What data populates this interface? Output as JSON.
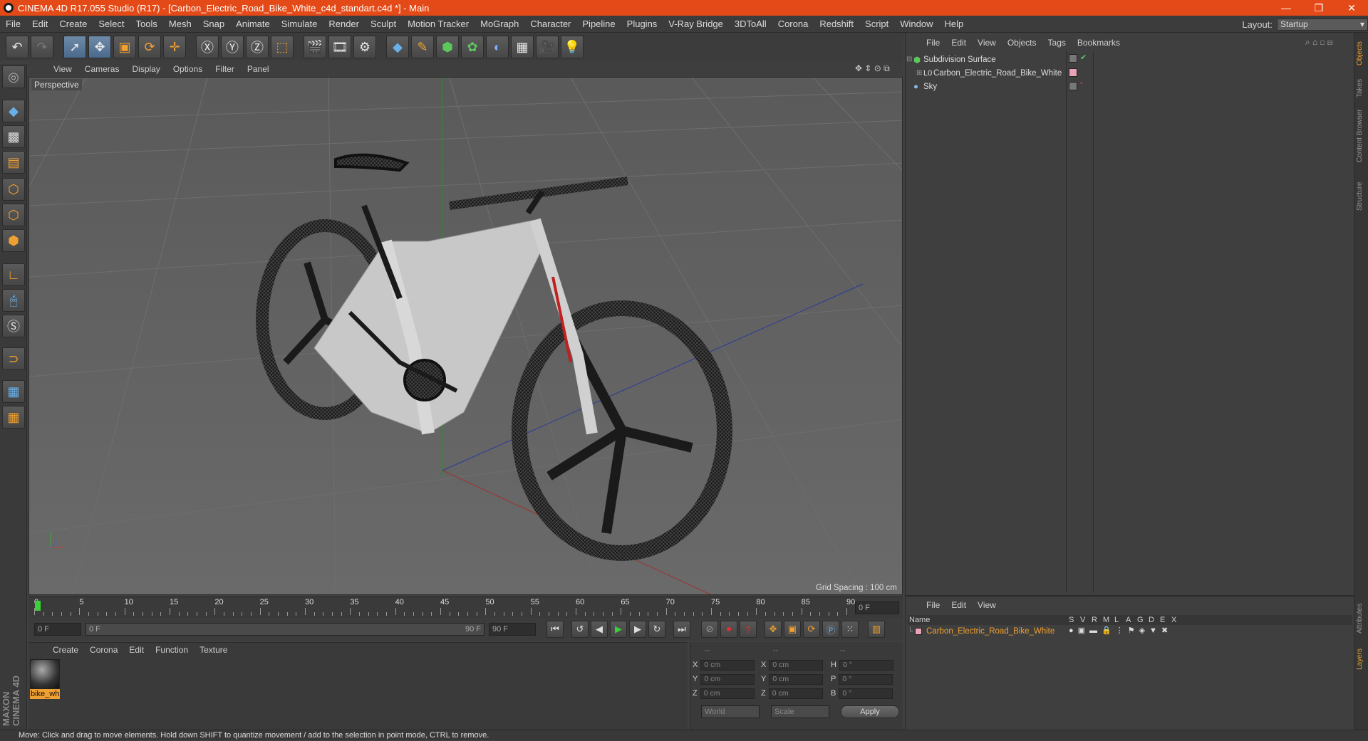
{
  "window": {
    "title": "CINEMA 4D R17.055 Studio (R17) - [Carbon_Electric_Road_Bike_White_c4d_standart.c4d *] - Main",
    "buttons": [
      "—",
      "❐",
      "✕"
    ]
  },
  "menubar": [
    "File",
    "Edit",
    "Create",
    "Select",
    "Tools",
    "Mesh",
    "Snap",
    "Animate",
    "Simulate",
    "Render",
    "Sculpt",
    "Motion Tracker",
    "MoGraph",
    "Character",
    "Pipeline",
    "Plugins",
    "V-Ray Bridge",
    "3DToAll",
    "Corona",
    "Redshift",
    "Script",
    "Window",
    "Help"
  ],
  "layout": {
    "label": "Layout:",
    "value": "Startup"
  },
  "viewport": {
    "menu": [
      "View",
      "Cameras",
      "Display",
      "Options",
      "Filter",
      "Panel"
    ],
    "label": "Perspective",
    "grid_spacing": "Grid Spacing : 100 cm"
  },
  "timeline": {
    "ticks": [
      "0",
      "5",
      "10",
      "15",
      "20",
      "25",
      "30",
      "35",
      "40",
      "45",
      "50",
      "55",
      "60",
      "65",
      "70",
      "75",
      "80",
      "85",
      "90"
    ],
    "current_frame": "0 F",
    "start": "0 F",
    "range_start": "0 F",
    "range_end": "90 F",
    "end": "90 F"
  },
  "material_manager": {
    "menu": [
      "Create",
      "Corona",
      "Edit",
      "Function",
      "Texture"
    ],
    "materials": [
      {
        "name": "bike_wh"
      }
    ]
  },
  "coordinates": {
    "headers": [
      "--",
      "--",
      "--"
    ],
    "rows": [
      {
        "a": "X",
        "av": "0 cm",
        "b": "X",
        "bv": "0 cm",
        "c": "H",
        "cv": "0 °"
      },
      {
        "a": "Y",
        "av": "0 cm",
        "b": "Y",
        "bv": "0 cm",
        "c": "P",
        "cv": "0 °"
      },
      {
        "a": "Z",
        "av": "0 cm",
        "b": "Z",
        "bv": "0 cm",
        "c": "B",
        "cv": "0 °"
      }
    ],
    "world": "World",
    "scale": "Scale",
    "apply": "Apply"
  },
  "object_manager": {
    "menu": [
      "File",
      "Edit",
      "View",
      "Objects",
      "Tags",
      "Bookmarks"
    ],
    "objects": [
      {
        "name": "Subdivision Surface",
        "indent": 0
      },
      {
        "name": "Carbon_Electric_Road_Bike_White",
        "indent": 1
      },
      {
        "name": "Sky",
        "indent": 0
      }
    ]
  },
  "layer_manager": {
    "menu": [
      "File",
      "Edit",
      "View"
    ],
    "columns": {
      "name": "Name",
      "flags": [
        "S",
        "V",
        "R",
        "M",
        "L",
        "A",
        "G",
        "D",
        "E",
        "X"
      ]
    },
    "layers": [
      {
        "name": "Carbon_Electric_Road_Bike_White",
        "color": "#e8a4b4"
      }
    ]
  },
  "right_tabs": [
    "Objects",
    "Takes",
    "Content Browser",
    "Structure",
    "Attributes",
    "Layers"
  ],
  "status": "Move: Click and drag to move elements. Hold down SHIFT to quantize movement / add to the selection in point mode, CTRL to remove.",
  "colors": {
    "titlebar": "#e44a17",
    "accent_orange": "#f0a030",
    "layer_text": "#f0a030"
  }
}
